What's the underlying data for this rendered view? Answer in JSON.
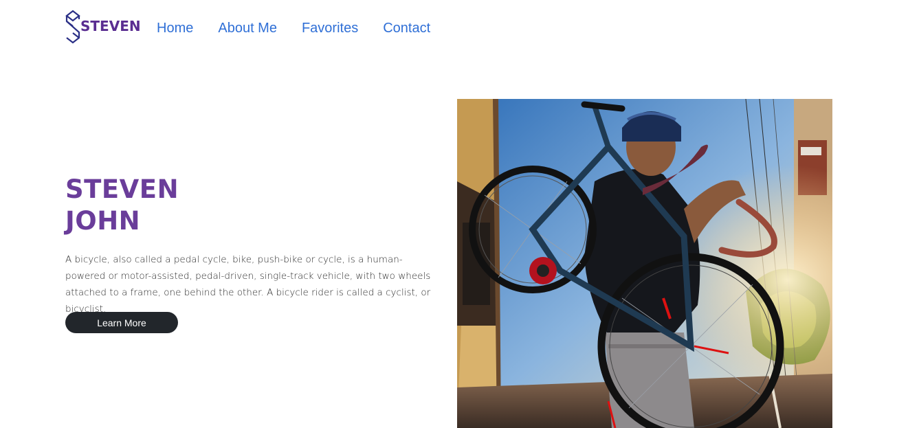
{
  "brand": {
    "logo_text": "STEVEN",
    "logo_icon": "s-monogram-icon",
    "color": "#5a2d91"
  },
  "nav": {
    "items": [
      {
        "label": "Home"
      },
      {
        "label": "About Me"
      },
      {
        "label": "Favorites"
      },
      {
        "label": "Contact"
      }
    ],
    "color": "#2f6fd6"
  },
  "hero": {
    "title_line1": "STEVEN",
    "title_line2": "JOHN",
    "title_color": "#6a3d9a",
    "description": "A bicycle, also called a pedal cycle, bike, push-bike or cycle, is a human-powered or motor-assisted, pedal-driven, single-track vehicle, with two wheels attached to a frame, one behind the other. A bicycle rider is called a cyclist, or bicyclist.",
    "button_label": "Learn More",
    "button_color": "#22262b",
    "image_subject": "cyclist-carrying-bicycle-photo"
  }
}
